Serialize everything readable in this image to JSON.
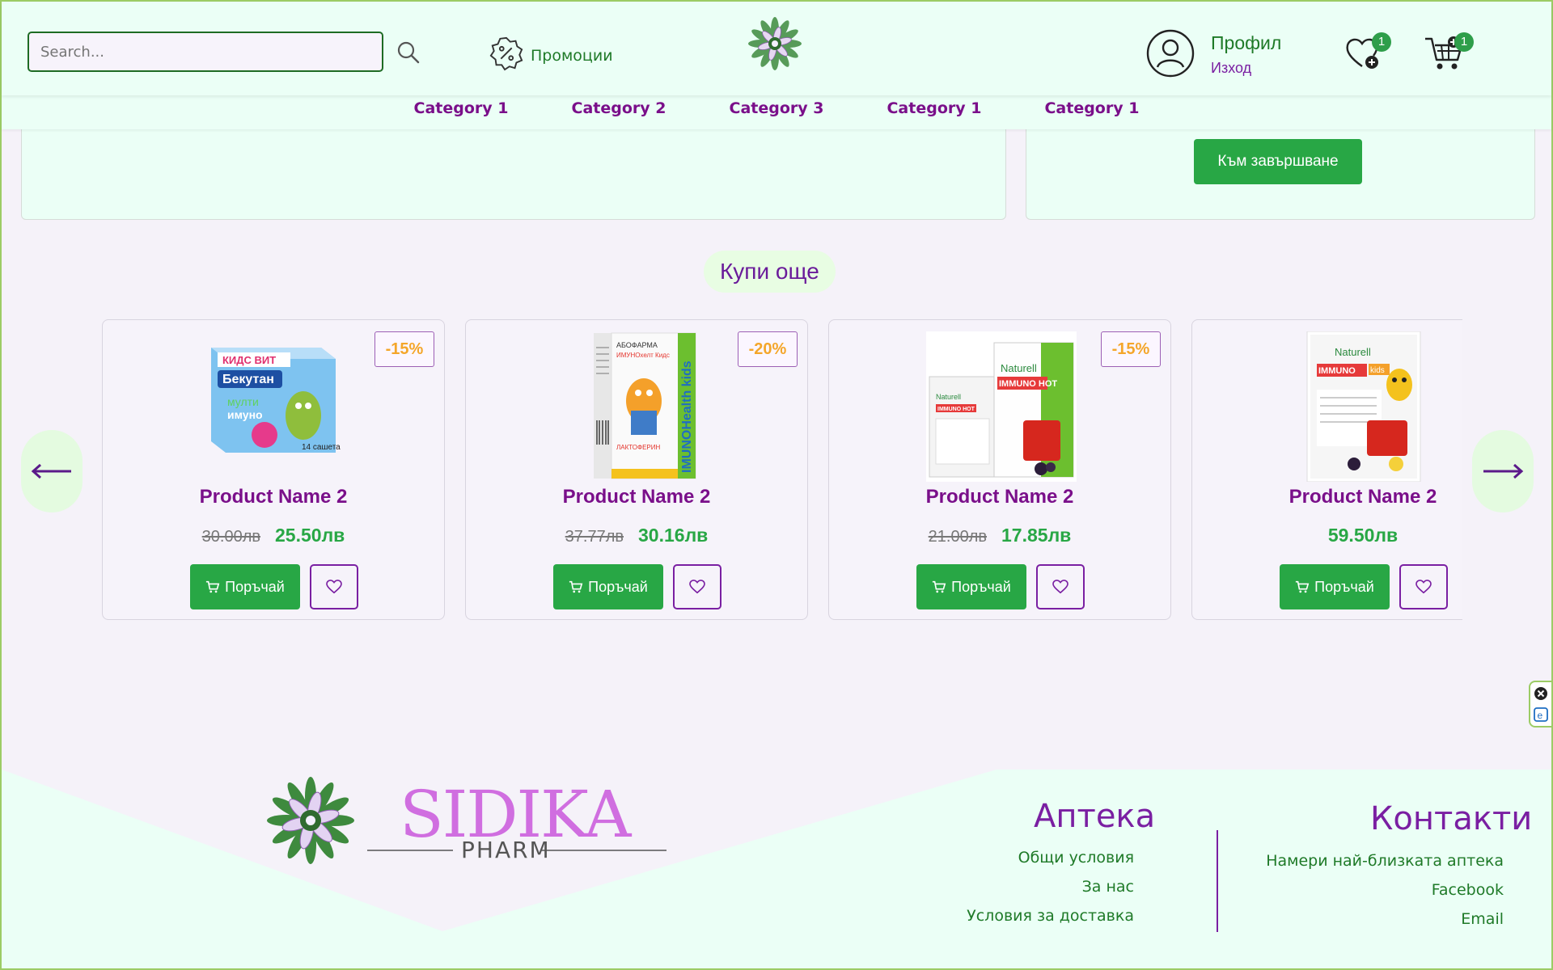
{
  "header": {
    "search_placeholder": "Search...",
    "promo_label": "Промоции",
    "profile_label": "Профил",
    "logout_label": "Изход",
    "wishlist_count": "1",
    "cart_count": "1"
  },
  "categories": [
    "Category 1",
    "Category 2",
    "Category 3",
    "Category 1",
    "Category 1"
  ],
  "checkout_button": "Към завършване",
  "section_title": "Купи още",
  "products": [
    {
      "name": "Product Name 2",
      "discount": "-15%",
      "old_price": "30.00лв",
      "price": "25.50лв",
      "order_label": "Поръчай",
      "image": "bekutan-box"
    },
    {
      "name": "Product Name 2",
      "discount": "-20%",
      "old_price": "37.77лв",
      "price": "30.16лв",
      "order_label": "Поръчай",
      "image": "imunohealth-kids-box"
    },
    {
      "name": "Product Name 2",
      "discount": "-15%",
      "old_price": "21.00лв",
      "price": "17.85лв",
      "order_label": "Поръчай",
      "image": "naturell-immuno-hot-box"
    },
    {
      "name": "Product Name 2",
      "discount": "",
      "old_price": "",
      "price": "59.50лв",
      "order_label": "Поръчай",
      "image": "naturell-immuno-kids-box"
    }
  ],
  "footer": {
    "logo_text": "SIDIKA",
    "logo_subtext": "PHARM",
    "pharmacy_heading": "Аптека",
    "pharmacy_links": [
      "Общи условия",
      "За нас",
      "Условия за доставка"
    ],
    "contacts_heading": "Контакти",
    "contacts_links": [
      "Намери най-близката аптека",
      "Facebook",
      "Email"
    ]
  },
  "colors": {
    "header_bg": "#ebfff6",
    "page_bg": "#f5f2f9",
    "brand_purple": "#7a1fa2",
    "brand_green": "#28a745",
    "discount_orange": "#f4a62a"
  },
  "icons": [
    "search-icon",
    "promo-percent-icon",
    "logo-flower-icon",
    "profile-icon",
    "wishlist-heart-icon",
    "cart-icon",
    "arrow-left-icon",
    "arrow-right-icon",
    "cart-small-icon",
    "heart-outline-icon",
    "close-circle-icon",
    "accessibility-icon"
  ]
}
